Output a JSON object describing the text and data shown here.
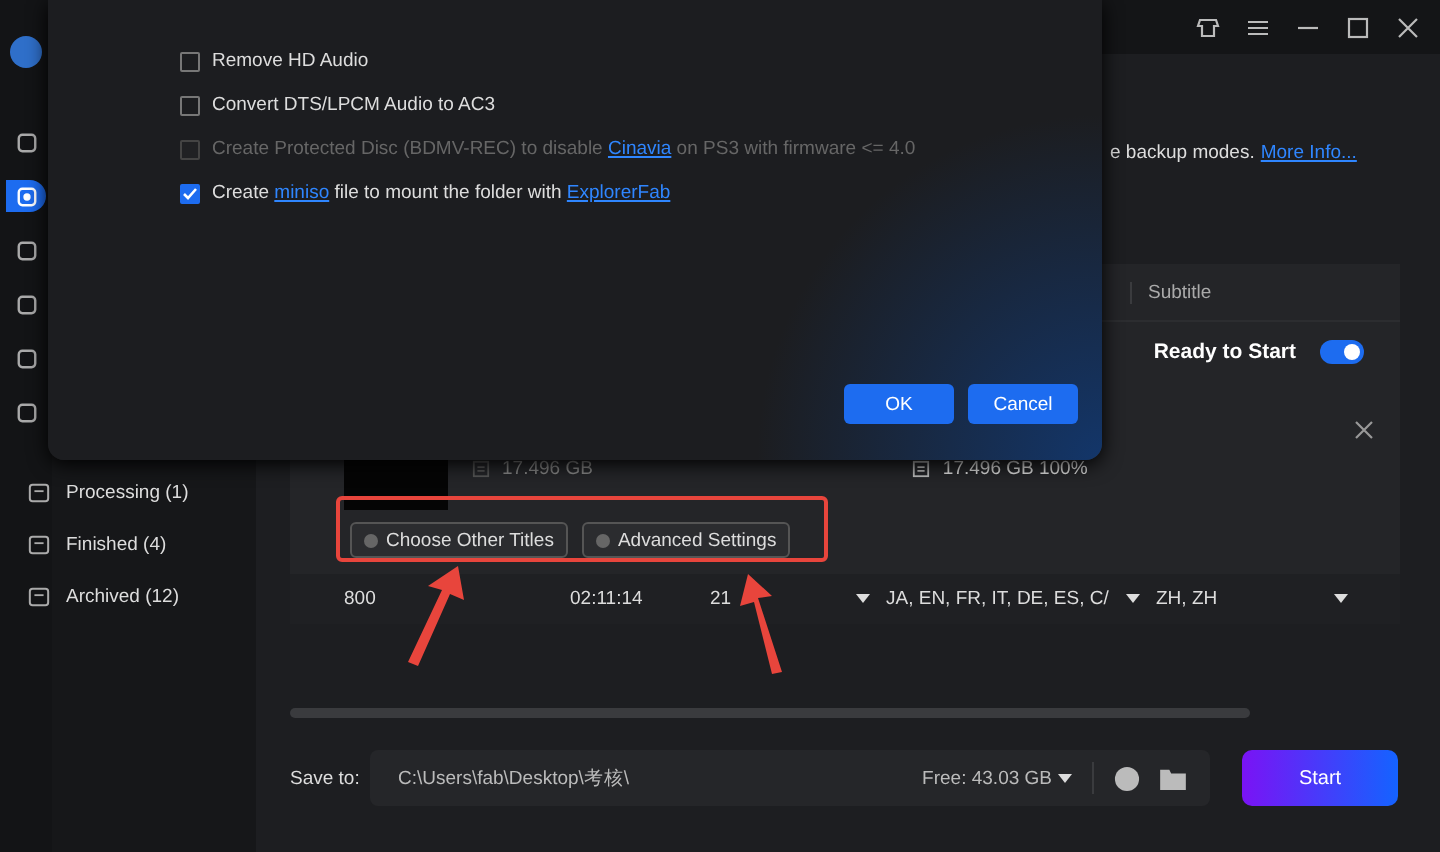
{
  "dialog": {
    "options": [
      {
        "checked": false,
        "disabled": false,
        "parts": [
          {
            "text": "Remove HD Audio",
            "kind": "text"
          }
        ]
      },
      {
        "checked": false,
        "disabled": false,
        "parts": [
          {
            "text": "Convert DTS/LPCM Audio to AC3",
            "kind": "text"
          }
        ]
      },
      {
        "checked": false,
        "disabled": true,
        "parts": [
          {
            "text": "Create Protected Disc (BDMV-REC) to disable ",
            "kind": "text"
          },
          {
            "text": "Cinavia",
            "kind": "link"
          },
          {
            "text": " on PS3 with firmware <= 4.0",
            "kind": "text"
          }
        ]
      },
      {
        "checked": true,
        "disabled": false,
        "parts": [
          {
            "text": "Create ",
            "kind": "text"
          },
          {
            "text": "miniso",
            "kind": "link"
          },
          {
            "text": " file to mount the folder with ",
            "kind": "text"
          },
          {
            "text": "ExplorerFab",
            "kind": "link"
          }
        ]
      }
    ],
    "buttons": [
      "OK",
      "Cancel"
    ]
  },
  "nav_rail": [
    {
      "selected": false
    },
    {
      "selected": true
    },
    {
      "selected": false
    },
    {
      "selected": false
    },
    {
      "selected": false
    },
    {
      "selected": false
    }
  ],
  "sidebar": {
    "items": [
      {
        "label": "Processing (1)",
        "selected": false
      },
      {
        "label": "Finished (4)",
        "selected": false
      },
      {
        "label": "Archived (12)",
        "selected": false
      }
    ]
  },
  "info": {
    "text": "e backup modes.",
    "link": "More Info..."
  },
  "table": {
    "header": "Subtitle",
    "title_row": {
      "status": "Ready to Start",
      "enabled": true,
      "source_size": "17.496 GB",
      "output": "17.496 GB 100%",
      "buttons": [
        "Choose Other Titles",
        "Advanced Settings"
      ]
    },
    "row": [
      {
        "text": "800",
        "dropdown": false
      },
      {
        "text": "02:11:14",
        "dropdown": false
      },
      {
        "text": "21",
        "dropdown": true
      },
      {
        "text": "JA, EN, FR, IT, DE, ES, C/",
        "dropdown": true
      },
      {
        "text": "ZH, ZH",
        "dropdown": true
      }
    ]
  },
  "save": {
    "label": "Save to:",
    "path": "C:\\Users\\fab\\Desktop\\考核\\",
    "free": "Free: 43.03 GB"
  },
  "start": "Start"
}
